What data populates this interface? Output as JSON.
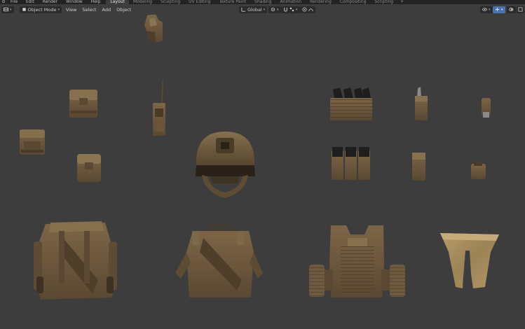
{
  "top_menu": [
    "File",
    "Edit",
    "Render",
    "Window",
    "Help"
  ],
  "workspace_tabs": [
    {
      "label": "Layout",
      "active": true
    },
    {
      "label": "Modeling",
      "active": false
    },
    {
      "label": "Sculpting",
      "active": false
    },
    {
      "label": "UV Editing",
      "active": false
    },
    {
      "label": "Texture Paint",
      "active": false
    },
    {
      "label": "Shading",
      "active": false
    },
    {
      "label": "Animation",
      "active": false
    },
    {
      "label": "Rendering",
      "active": false
    },
    {
      "label": "Compositing",
      "active": false
    },
    {
      "label": "Scripting",
      "active": false
    }
  ],
  "add_workspace": "+",
  "viewport_header": {
    "mode": "Object Mode",
    "menus": [
      "View",
      "Select",
      "Add",
      "Object"
    ],
    "transform_orientation": "Global"
  },
  "colors": {
    "topbar": "#232323",
    "viewport_bg": "#3d3d3d",
    "gear_base": "#6e5a3f",
    "gear_light": "#8a7250",
    "gear_dark": "#4a3b28",
    "gear_shadow": "#2f2519",
    "mag_black": "#1e1e1e",
    "camo": "#a58a5c"
  },
  "icons": [
    "editor-type-icon",
    "object-mode-icon",
    "orientation-icon",
    "pivot-icon",
    "snap-icon",
    "proportional-icon",
    "visibility-icon",
    "gizmo-icon",
    "overlay-icon",
    "xray-icon",
    "shading-icon"
  ]
}
